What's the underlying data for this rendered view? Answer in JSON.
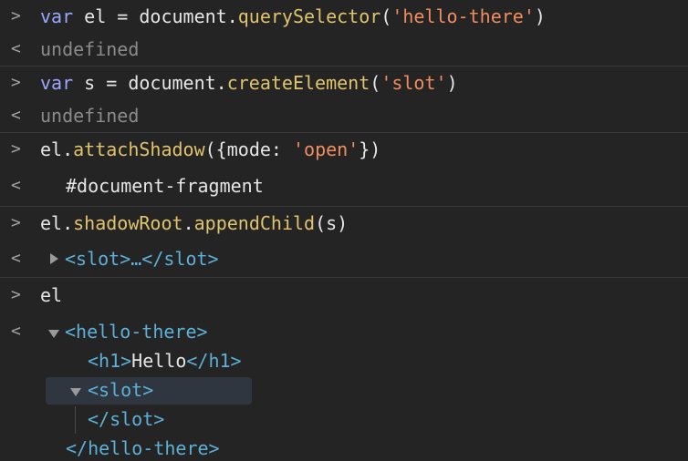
{
  "console": {
    "lines": [
      {
        "kind": "input",
        "tokens": [
          "var",
          " el = ",
          "document",
          ".",
          "querySelector",
          "(",
          "'hello-there'",
          ")"
        ]
      },
      {
        "kind": "output",
        "text": "undefined"
      },
      {
        "kind": "input",
        "tokens": [
          "var",
          " s = ",
          "document",
          ".",
          "createElement",
          "(",
          "'slot'",
          ")"
        ]
      },
      {
        "kind": "output",
        "text": "undefined"
      },
      {
        "kind": "input",
        "tokens": [
          "el",
          ".",
          "attachShadow",
          "({",
          "mode",
          ": ",
          "'open'",
          "})"
        ]
      },
      {
        "kind": "output",
        "text": "#document-fragment"
      },
      {
        "kind": "input",
        "tokens": [
          "el",
          ".",
          "shadowRoot",
          ".",
          "appendChild",
          "(s)"
        ]
      },
      {
        "kind": "output",
        "text": "<slot>…</slot>"
      },
      {
        "kind": "input",
        "text": "el"
      },
      {
        "kind": "output",
        "tree": {
          "open_tag": "<hello-there>",
          "h1_open": "<h1>",
          "h1_text": "Hello",
          "h1_close": "</h1>",
          "slot_open": "<slot>",
          "slot_close": "</slot>",
          "close_tag": "</hello-there>"
        }
      }
    ],
    "glyphs": {
      "input": ">",
      "output": "<"
    }
  }
}
